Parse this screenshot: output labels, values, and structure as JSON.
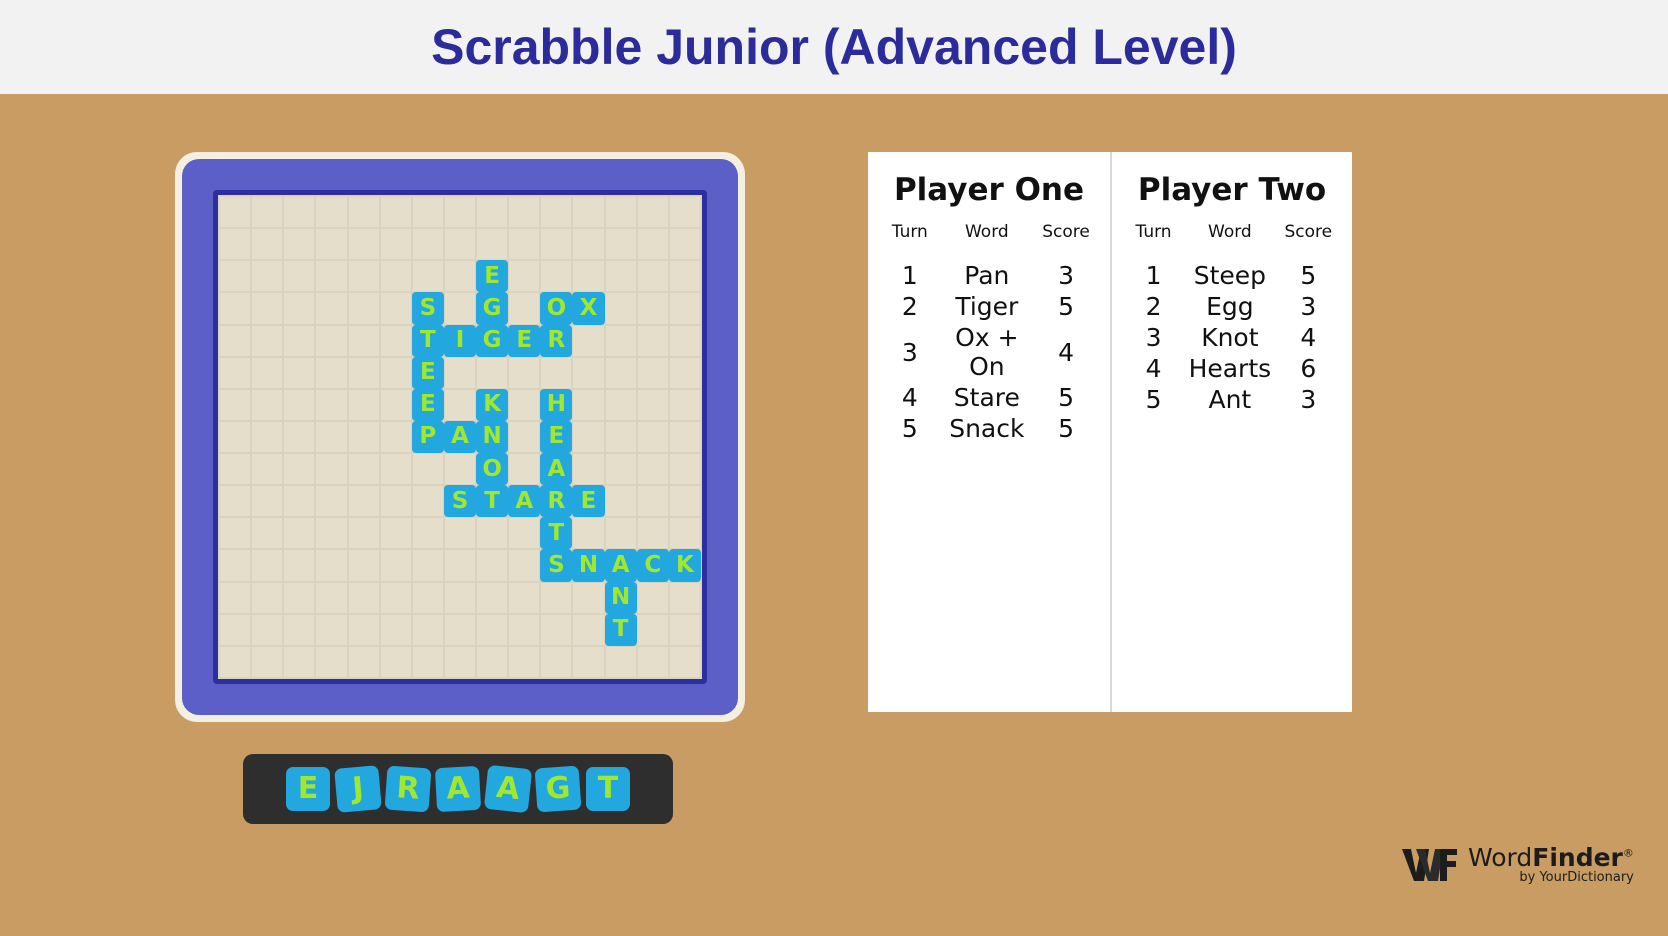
{
  "header": {
    "title": "Scrabble Junior (Advanced Level)",
    "background": "#F2F2F2",
    "title_color": "#2B2B9B"
  },
  "theme": {
    "page_background": "#C99C63",
    "board_frame": "#5B5FC7",
    "board_inner_frame": "#2E2E9E",
    "grid_cell": "#E4DECB",
    "tile_background": "#22A7DE",
    "tile_letter": "#A0E830",
    "rack_background": "#2E2E2E"
  },
  "board": {
    "rows": 15,
    "columns": 15,
    "tiles": [
      {
        "row": 2,
        "col": 8,
        "letter": "E"
      },
      {
        "row": 3,
        "col": 6,
        "letter": "S"
      },
      {
        "row": 3,
        "col": 8,
        "letter": "G"
      },
      {
        "row": 3,
        "col": 10,
        "letter": "O"
      },
      {
        "row": 3,
        "col": 11,
        "letter": "X"
      },
      {
        "row": 4,
        "col": 6,
        "letter": "T"
      },
      {
        "row": 4,
        "col": 7,
        "letter": "I"
      },
      {
        "row": 4,
        "col": 8,
        "letter": "G"
      },
      {
        "row": 4,
        "col": 9,
        "letter": "E"
      },
      {
        "row": 4,
        "col": 10,
        "letter": "R"
      },
      {
        "row": 5,
        "col": 6,
        "letter": "E"
      },
      {
        "row": 6,
        "col": 6,
        "letter": "E"
      },
      {
        "row": 6,
        "col": 8,
        "letter": "K"
      },
      {
        "row": 6,
        "col": 10,
        "letter": "H"
      },
      {
        "row": 7,
        "col": 6,
        "letter": "P"
      },
      {
        "row": 7,
        "col": 7,
        "letter": "A"
      },
      {
        "row": 7,
        "col": 8,
        "letter": "N"
      },
      {
        "row": 7,
        "col": 10,
        "letter": "E"
      },
      {
        "row": 8,
        "col": 8,
        "letter": "O"
      },
      {
        "row": 8,
        "col": 10,
        "letter": "A"
      },
      {
        "row": 9,
        "col": 7,
        "letter": "S"
      },
      {
        "row": 9,
        "col": 8,
        "letter": "T"
      },
      {
        "row": 9,
        "col": 9,
        "letter": "A"
      },
      {
        "row": 9,
        "col": 10,
        "letter": "R"
      },
      {
        "row": 9,
        "col": 11,
        "letter": "E"
      },
      {
        "row": 10,
        "col": 10,
        "letter": "T"
      },
      {
        "row": 11,
        "col": 10,
        "letter": "S"
      },
      {
        "row": 11,
        "col": 11,
        "letter": "N"
      },
      {
        "row": 11,
        "col": 12,
        "letter": "A"
      },
      {
        "row": 11,
        "col": 13,
        "letter": "C"
      },
      {
        "row": 11,
        "col": 14,
        "letter": "K"
      },
      {
        "row": 12,
        "col": 12,
        "letter": "N"
      },
      {
        "row": 13,
        "col": 12,
        "letter": "T"
      }
    ]
  },
  "rack": {
    "tiles": [
      "E",
      "J",
      "R",
      "A",
      "A",
      "G",
      "T"
    ]
  },
  "scoreboard": {
    "columns": [
      "Turn",
      "Word",
      "Score"
    ],
    "players": [
      {
        "name": "Player One",
        "rows": [
          {
            "turn": "1",
            "word": "Pan",
            "score": "3"
          },
          {
            "turn": "2",
            "word": "Tiger",
            "score": "5"
          },
          {
            "turn": "3",
            "word": "Ox + On",
            "score": "4"
          },
          {
            "turn": "4",
            "word": "Stare",
            "score": "5"
          },
          {
            "turn": "5",
            "word": "Snack",
            "score": "5"
          }
        ]
      },
      {
        "name": "Player Two",
        "rows": [
          {
            "turn": "1",
            "word": "Steep",
            "score": "5"
          },
          {
            "turn": "2",
            "word": "Egg",
            "score": "3"
          },
          {
            "turn": "3",
            "word": "Knot",
            "score": "4"
          },
          {
            "turn": "4",
            "word": "Hearts",
            "score": "6"
          },
          {
            "turn": "5",
            "word": "Ant",
            "score": "3"
          }
        ]
      }
    ]
  },
  "logo": {
    "monogram": "WF",
    "name_first": "Word",
    "name_second": "Finder",
    "registered": "®",
    "tagline": "by YourDictionary"
  }
}
